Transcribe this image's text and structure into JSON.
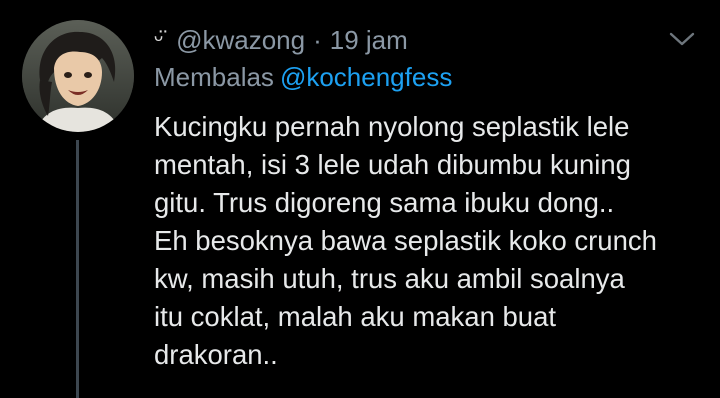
{
  "tweet": {
    "display_name": "ᵕ̈",
    "handle": "@kwazong",
    "separator": "·",
    "time": "19 jam",
    "reply_prefix": "Membalas",
    "reply_to": "@kochengfess",
    "lines": [
      "Kucingku pernah nyolong seplastik lele",
      "mentah, isi 3 lele udah dibumbu kuning",
      "gitu. Trus digoreng sama ibuku dong..",
      "Eh besoknya bawa seplastik koko crunch",
      "kw, masih utuh, trus aku ambil soalnya",
      "itu coklat, malah aku makan buat",
      "drakoran.."
    ]
  },
  "icons": {
    "menu": "chevron-down-icon",
    "avatar": "avatar-image"
  },
  "colors": {
    "background": "#000000",
    "text": "#e7e9ea",
    "secondary": "#8b98a5",
    "accent": "#1da1f2",
    "thread_line": "#3d4750"
  }
}
